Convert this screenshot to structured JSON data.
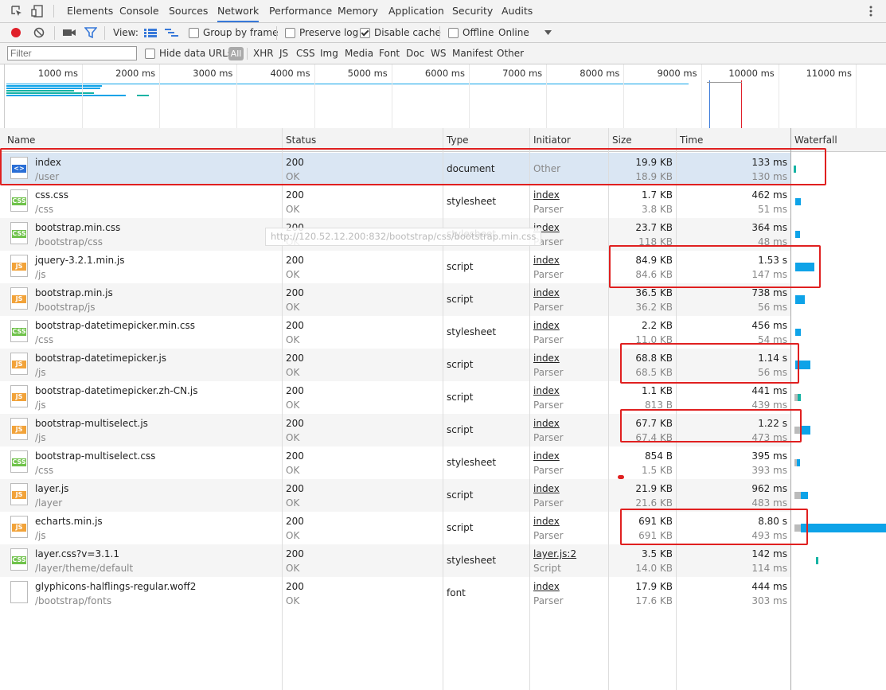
{
  "tabs": [
    "Elements",
    "Console",
    "Sources",
    "Network",
    "Performance",
    "Memory",
    "Application",
    "Security",
    "Audits"
  ],
  "toolbar": {
    "view_label": "View:",
    "group_by_frame": "Group by frame",
    "preserve_log": "Preserve log",
    "disable_cache": "Disable cache",
    "offline": "Offline",
    "throttle": "Online"
  },
  "filterbar": {
    "placeholder": "Filter",
    "hide_data_urls": "Hide data URLs",
    "types": [
      "All",
      "XHR",
      "JS",
      "CSS",
      "Img",
      "Media",
      "Font",
      "Doc",
      "WS",
      "Manifest",
      "Other"
    ]
  },
  "overview": {
    "ticks": [
      "1000 ms",
      "2000 ms",
      "3000 ms",
      "4000 ms",
      "5000 ms",
      "6000 ms",
      "7000 ms",
      "8000 ms",
      "9000 ms",
      "10000 ms",
      "11000 ms"
    ]
  },
  "columns": [
    "Name",
    "Status",
    "Type",
    "Initiator",
    "Size",
    "Time",
    "Waterfall"
  ],
  "tooltip": "http://120.52.12.200:832/bootstrap/css/bootstrap.min.css",
  "rows": [
    {
      "name": "index",
      "path": "/user",
      "status": "200",
      "status_text": "OK",
      "type": "document",
      "initiator": "Other",
      "initiator_sub": "",
      "size": "19.9 KB",
      "size2": "18.9 KB",
      "time": "133 ms",
      "time2": "130 ms",
      "icon": "doc"
    },
    {
      "name": "css.css",
      "path": "/css",
      "status": "200",
      "status_text": "OK",
      "type": "stylesheet",
      "initiator": "index",
      "initiator_sub": "Parser",
      "size": "1.7 KB",
      "size2": "3.8 KB",
      "time": "462 ms",
      "time2": "51 ms",
      "icon": "css"
    },
    {
      "name": "bootstrap.min.css",
      "path": "/bootstrap/css",
      "status": "200",
      "status_text": "OK",
      "type": "stylesheet",
      "initiator": "index",
      "initiator_sub": "Parser",
      "size": "23.7 KB",
      "size2": "118 KB",
      "time": "364 ms",
      "time2": "48 ms",
      "icon": "css"
    },
    {
      "name": "jquery-3.2.1.min.js",
      "path": "/js",
      "status": "200",
      "status_text": "OK",
      "type": "script",
      "initiator": "index",
      "initiator_sub": "Parser",
      "size": "84.9 KB",
      "size2": "84.6 KB",
      "time": "1.53 s",
      "time2": "147 ms",
      "icon": "js"
    },
    {
      "name": "bootstrap.min.js",
      "path": "/bootstrap/js",
      "status": "200",
      "status_text": "OK",
      "type": "script",
      "initiator": "index",
      "initiator_sub": "Parser",
      "size": "36.5 KB",
      "size2": "36.2 KB",
      "time": "738 ms",
      "time2": "56 ms",
      "icon": "js"
    },
    {
      "name": "bootstrap-datetimepicker.min.css",
      "path": "/css",
      "status": "200",
      "status_text": "OK",
      "type": "stylesheet",
      "initiator": "index",
      "initiator_sub": "Parser",
      "size": "2.2 KB",
      "size2": "11.0 KB",
      "time": "456 ms",
      "time2": "54 ms",
      "icon": "css"
    },
    {
      "name": "bootstrap-datetimepicker.js",
      "path": "/js",
      "status": "200",
      "status_text": "OK",
      "type": "script",
      "initiator": "index",
      "initiator_sub": "Parser",
      "size": "68.8 KB",
      "size2": "68.5 KB",
      "time": "1.14 s",
      "time2": "56 ms",
      "icon": "js"
    },
    {
      "name": "bootstrap-datetimepicker.zh-CN.js",
      "path": "/js",
      "status": "200",
      "status_text": "OK",
      "type": "script",
      "initiator": "index",
      "initiator_sub": "Parser",
      "size": "1.1 KB",
      "size2": "813 B",
      "time": "441 ms",
      "time2": "439 ms",
      "icon": "js"
    },
    {
      "name": "bootstrap-multiselect.js",
      "path": "/js",
      "status": "200",
      "status_text": "OK",
      "type": "script",
      "initiator": "index",
      "initiator_sub": "Parser",
      "size": "67.7 KB",
      "size2": "67.4 KB",
      "time": "1.22 s",
      "time2": "473 ms",
      "icon": "js"
    },
    {
      "name": "bootstrap-multiselect.css",
      "path": "/css",
      "status": "200",
      "status_text": "OK",
      "type": "stylesheet",
      "initiator": "index",
      "initiator_sub": "Parser",
      "size": "854 B",
      "size2": "1.5 KB",
      "time": "395 ms",
      "time2": "393 ms",
      "icon": "css"
    },
    {
      "name": "layer.js",
      "path": "/layer",
      "status": "200",
      "status_text": "OK",
      "type": "script",
      "initiator": "index",
      "initiator_sub": "Parser",
      "size": "21.9 KB",
      "size2": "21.6 KB",
      "time": "962 ms",
      "time2": "483 ms",
      "icon": "js"
    },
    {
      "name": "echarts.min.js",
      "path": "/js",
      "status": "200",
      "status_text": "OK",
      "type": "script",
      "initiator": "index",
      "initiator_sub": "Parser",
      "size": "691 KB",
      "size2": "691 KB",
      "time": "8.80 s",
      "time2": "493 ms",
      "icon": "js"
    },
    {
      "name": "layer.css?v=3.1.1",
      "path": "/layer/theme/default",
      "status": "200",
      "status_text": "OK",
      "type": "stylesheet",
      "initiator": "layer.js:2",
      "initiator_sub": "Script",
      "size": "3.5 KB",
      "size2": "14.0 KB",
      "time": "142 ms",
      "time2": "114 ms",
      "icon": "css"
    },
    {
      "name": "glyphicons-halflings-regular.woff2",
      "path": "/bootstrap/fonts",
      "status": "200",
      "status_text": "OK",
      "type": "font",
      "initiator": "index",
      "initiator_sub": "Parser",
      "size": "17.9 KB",
      "size2": "17.6 KB",
      "time": "444 ms",
      "time2": "303 ms",
      "icon": "blank"
    }
  ],
  "colors": {
    "accent": "#3879d9",
    "waterfall": "#0ea3e8",
    "highlight": "#e02020",
    "record": "#e0202a"
  }
}
